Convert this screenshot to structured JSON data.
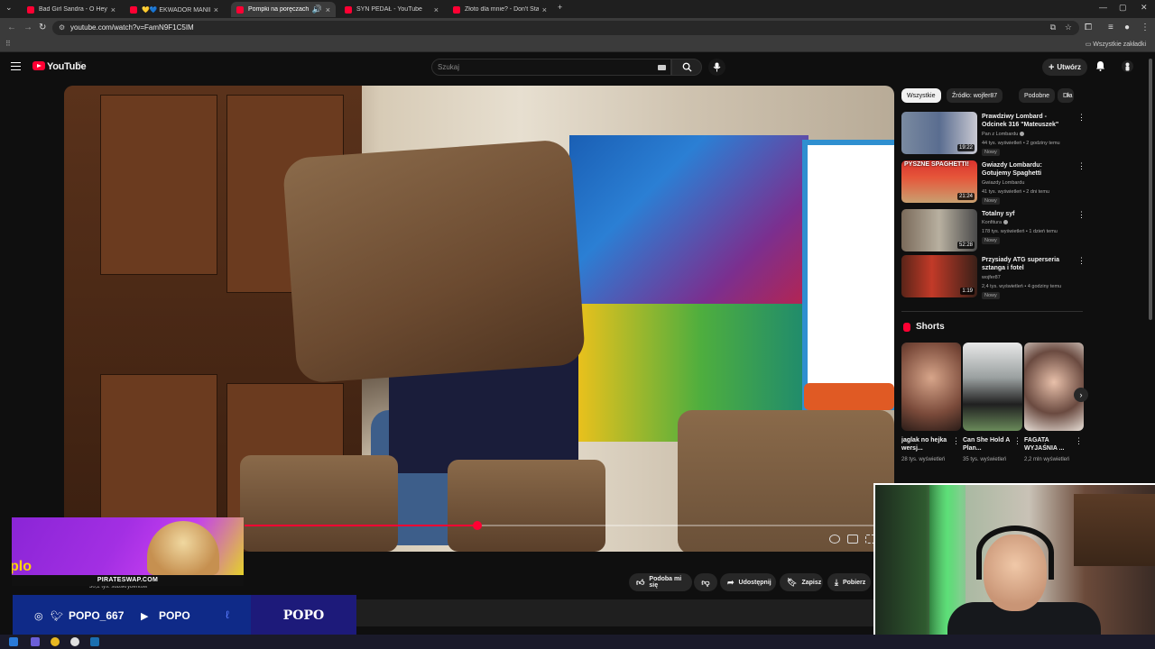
{
  "browser": {
    "tabs": [
      {
        "title": "Bad Girl Sandra - O Hey ! - You",
        "active": false
      },
      {
        "title": "💛💙 EKWADOR MANIECZKI",
        "active": false
      },
      {
        "title": "Pompki na poręczach z fot",
        "active": true
      },
      {
        "title": "SYN PEDAŁ - YouTube",
        "active": false
      },
      {
        "title": "Złoto dla mnie? - Don't Starve",
        "active": false
      }
    ],
    "url": "youtube.com/watch?v=FamN9F1C5IM",
    "all_bookmarks_label": "Wszystkie zakładki"
  },
  "youtube": {
    "logo_text": "YouTube",
    "logo_country": "MT",
    "search_placeholder": "Szukaj",
    "create_label": "Utwórz"
  },
  "player": {
    "progress": 0.37
  },
  "actions": {
    "like_label": "Podoba mi się",
    "share_label": "Udostępnij",
    "save_label": "Zapisz",
    "download_label": "Pobierz"
  },
  "channel": {
    "subscribers": "30,2 tys. subskrybentów"
  },
  "sidebar": {
    "chips": [
      {
        "label": "Wszystkie",
        "active": true
      },
      {
        "label": "Źródło: wojfer87",
        "active": false
      },
      {
        "label": "Podobne",
        "active": false
      },
      {
        "label": "Dla",
        "active": false
      }
    ],
    "recommendations": [
      {
        "title": "Prawdziwy Lombard - Odcinek 316 \"Mateuszek\"",
        "channel": "Pan z Lombardu",
        "meta": "44 tys. wyświetleń • 2 godziny temu",
        "badge": "Nowy",
        "duration": "19:22"
      },
      {
        "title": "Gwiazdy Lombardu: Gotujemy Spaghetti",
        "channel": "Gwiazdy Lombardu",
        "meta": "41 tys. wyświetleń • 2 dni temu",
        "badge": "Nowy",
        "duration": "21:24"
      },
      {
        "title": "Totalny syf",
        "channel": "Konfitura",
        "meta": "178 tys. wyświetleń • 1 dzień temu",
        "badge": "Nowy",
        "duration": "52:28"
      },
      {
        "title": "Przysiady ATG superseria sztanga i fotel",
        "channel": "wojfer87",
        "meta": "2,4 tys. wyświetleń • 4 godziny temu",
        "badge": "Nowy",
        "duration": "1:19"
      }
    ],
    "thumb_captions": {
      "spaghetti": "PYSZNE SPAGHETTI!"
    },
    "shorts_title": "Shorts",
    "shorts": [
      {
        "title": "jaglak no hejka wersj...",
        "views": "28 tys. wyświetleń"
      },
      {
        "title": "Can She Hold A Plan...",
        "views": "35 tys. wyświetleń"
      },
      {
        "title": "FAGATA WYJAŚNIA ...",
        "views": "2,2 mln wyświetleń"
      }
    ]
  },
  "overlay": {
    "banner_url": "PIRATESWAP.COM",
    "social_handle": "POPO_667",
    "youtube_handle": "POPO",
    "brand": "POPO",
    "banner_fragment": "plo"
  },
  "colors": {
    "accent": "#ff0033",
    "social_bg": "#0f2a88"
  }
}
